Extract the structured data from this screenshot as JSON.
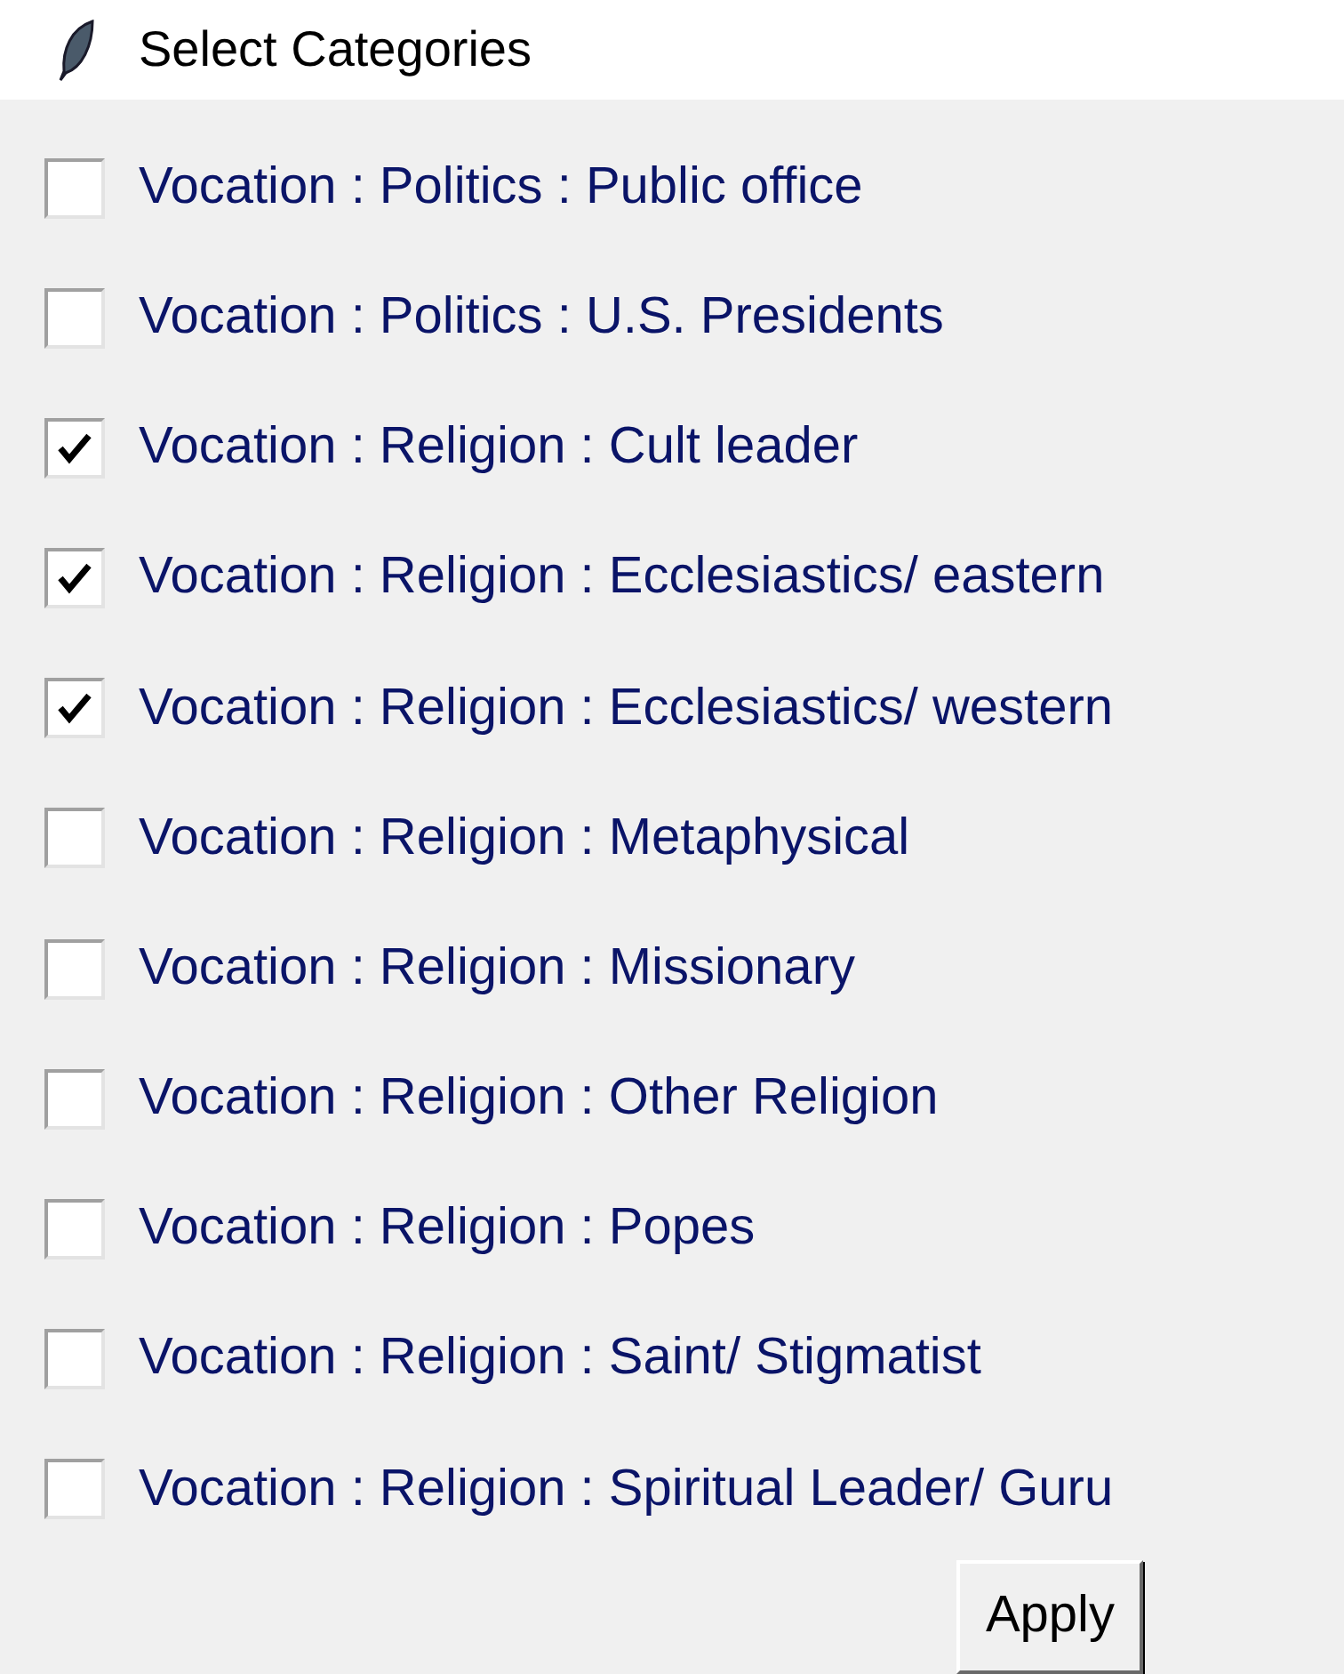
{
  "window": {
    "title": "Select Categories"
  },
  "categories": [
    {
      "label": "Vocation : Politics : Public office",
      "checked": false
    },
    {
      "label": "Vocation : Politics : U.S. Presidents",
      "checked": false
    },
    {
      "label": "Vocation : Religion : Cult leader",
      "checked": true
    },
    {
      "label": "Vocation : Religion : Ecclesiastics/ eastern",
      "checked": true
    },
    {
      "label": "Vocation : Religion : Ecclesiastics/ western",
      "checked": true
    },
    {
      "label": "Vocation : Religion : Metaphysical",
      "checked": false
    },
    {
      "label": "Vocation : Religion : Missionary",
      "checked": false
    },
    {
      "label": "Vocation : Religion : Other Religion",
      "checked": false
    },
    {
      "label": "Vocation : Religion : Popes",
      "checked": false
    },
    {
      "label": "Vocation : Religion : Saint/ Stigmatist",
      "checked": false
    },
    {
      "label": "Vocation : Religion : Spiritual Leader/ Guru",
      "checked": false
    }
  ],
  "buttons": [
    "Apply"
  ]
}
